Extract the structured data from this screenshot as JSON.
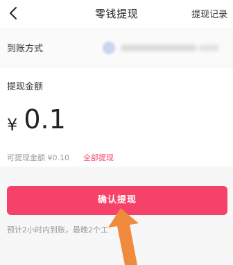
{
  "header": {
    "back_icon": "chevron-left-icon",
    "title": "零钱提现",
    "records_label": "提现记录"
  },
  "account": {
    "label": "到账方式",
    "value_obscured": true
  },
  "amount": {
    "label": "提现金额",
    "currency_symbol": "¥",
    "value": "0.1"
  },
  "available": {
    "text": "可提现金额 ¥0.10",
    "withdraw_all_label": "全部提现"
  },
  "confirm": {
    "label": "确认提现"
  },
  "eta": {
    "text": "预计2小时内到账，最晚2个工"
  },
  "colors": {
    "accent": "#f64168",
    "link": "#f2456b",
    "arrow": "#f08a3c"
  },
  "annotation": {
    "arrow_icon": "pointer-arrow-icon"
  }
}
